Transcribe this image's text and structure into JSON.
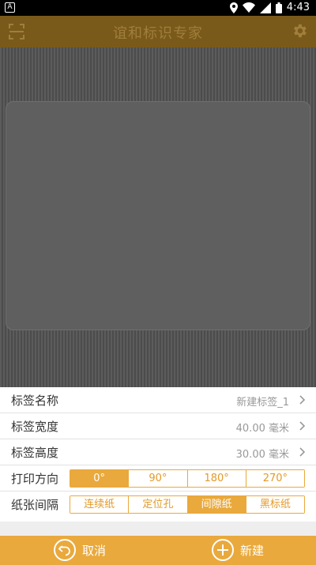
{
  "status": {
    "badge": "A",
    "time": "4:43"
  },
  "appbar": {
    "title": "谊和标识专家"
  },
  "rows": {
    "name": {
      "label": "标签名称",
      "value": "新建标签_1"
    },
    "width": {
      "label": "标签宽度",
      "value": "40.00 毫米"
    },
    "height": {
      "label": "标签高度",
      "value": "30.00 毫米"
    },
    "direction": {
      "label": "打印方向",
      "options": [
        "0°",
        "90°",
        "180°",
        "270°"
      ],
      "selected": "0°"
    },
    "paper": {
      "label": "纸张间隔",
      "options": [
        "连续纸",
        "定位孔",
        "间隙纸",
        "黑标纸"
      ],
      "selected": "间隙纸"
    }
  },
  "bottom": {
    "cancel": "取消",
    "new": "新建"
  },
  "colors": {
    "accent": "#e9a93c",
    "appbar": "#7a5a1a"
  }
}
